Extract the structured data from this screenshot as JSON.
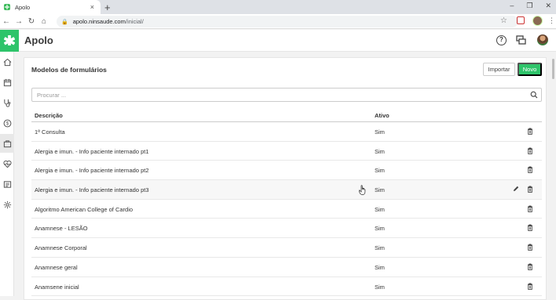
{
  "browser": {
    "tab_title": "Apolo",
    "tab_close": "×",
    "new_tab": "+",
    "url_host": "apolo.ninsaude.com",
    "url_path": "/inicial/",
    "window_controls": [
      "–",
      "❐",
      "✕"
    ]
  },
  "app": {
    "brand": "Apolo",
    "accent_color": "#2ec46a"
  },
  "sidebar": {
    "items": [
      {
        "icon": "home-icon"
      },
      {
        "icon": "calendar-icon"
      },
      {
        "icon": "stethoscope-icon"
      },
      {
        "icon": "dollar-icon"
      },
      {
        "icon": "briefcase-icon",
        "active": true
      },
      {
        "icon": "heart-pulse-icon"
      },
      {
        "icon": "report-icon"
      },
      {
        "icon": "settings-icon"
      }
    ]
  },
  "page": {
    "title": "Modelos de formulários",
    "import_label": "Importar",
    "new_label": "Novo",
    "search_placeholder": "Procurar ..."
  },
  "table": {
    "columns": [
      "Descrição",
      "Ativo"
    ],
    "rows": [
      {
        "descricao": "1ª Consulta",
        "ativo": "Sim"
      },
      {
        "descricao": "Alergia e imun. - Info paciente internado pt1",
        "ativo": "Sim"
      },
      {
        "descricao": "Alergia e imun. - Info paciente internado pt2",
        "ativo": "Sim"
      },
      {
        "descricao": "Alergia e imun. - Info paciente internado pt3",
        "ativo": "Sim",
        "hovered": true
      },
      {
        "descricao": "Algoritmo American College of Cardio",
        "ativo": "Sim"
      },
      {
        "descricao": "Anamnese - LESÃO",
        "ativo": "Sim"
      },
      {
        "descricao": "Anamnese Corporal",
        "ativo": "Sim"
      },
      {
        "descricao": "Anamnese geral",
        "ativo": "Sim"
      },
      {
        "descricao": "Anamsene inicial",
        "ativo": "Sim"
      }
    ]
  }
}
